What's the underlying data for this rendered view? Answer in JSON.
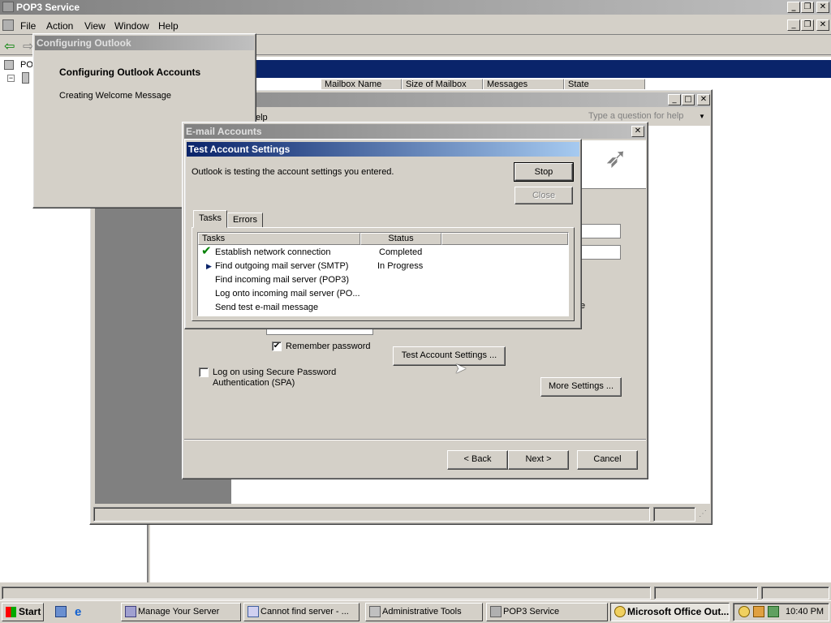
{
  "main_window": {
    "title": "POP3 Service",
    "menu": [
      "File",
      "Action",
      "View",
      "Window",
      "Help"
    ],
    "tree_root": "POP",
    "columns": [
      "Mailbox Name",
      "Size of Mailbox",
      "Messages",
      "State"
    ]
  },
  "configuring": {
    "title": "Configuring Outlook",
    "heading": "Configuring Outlook Accounts",
    "status": "Creating Welcome Message"
  },
  "outlook_window": {
    "help_partial": "elp",
    "question_placeholder": "Type a question for help"
  },
  "email_accounts": {
    "title": "E-mail Accounts",
    "remember_password": "Remember password",
    "remember_checked": true,
    "spa_label_line1": "Log on using Secure Password",
    "spa_label_line2": "Authentication (SPA)",
    "spa_checked": false,
    "test_button": "Test Account Settings ...",
    "more_settings": "More Settings ...",
    "back": "< Back",
    "next": "Next >",
    "cancel": "Cancel",
    "partial_e": "e"
  },
  "test_dialog": {
    "title": "Test Account Settings",
    "message": "Outlook is testing the account settings you entered.",
    "stop": "Stop",
    "close": "Close",
    "tabs": [
      "Tasks",
      "Errors"
    ],
    "columns": [
      "Tasks",
      "Status"
    ],
    "rows": [
      {
        "task": "Establish network connection",
        "status": "Completed",
        "marker": "check"
      },
      {
        "task": "Find outgoing mail server (SMTP)",
        "status": "In Progress",
        "marker": "arrow"
      },
      {
        "task": "Find incoming mail server (POP3)",
        "status": "",
        "marker": ""
      },
      {
        "task": "Log onto incoming mail server (PO...",
        "status": "",
        "marker": ""
      },
      {
        "task": "Send test e-mail message",
        "status": "",
        "marker": ""
      }
    ]
  },
  "taskbar": {
    "start": "Start",
    "buttons": [
      "Manage Your Server",
      "Cannot find server - ...",
      "Administrative Tools",
      "POP3 Service",
      "Microsoft Office Out..."
    ],
    "clock": "10:40 PM"
  },
  "colors": {
    "active_title": "#0a246a",
    "inactive_title": "#808080",
    "face": "#d4d0c8",
    "check_green": "#008000"
  }
}
